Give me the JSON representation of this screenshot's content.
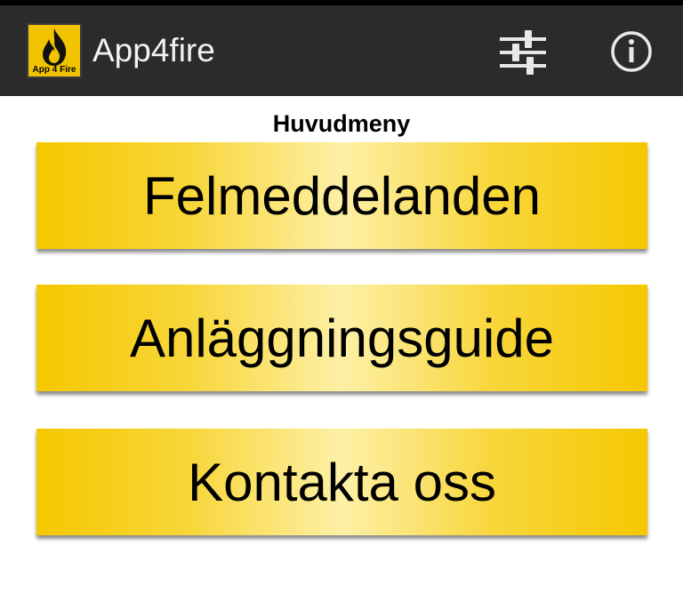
{
  "app": {
    "title": "App4fire",
    "logo_text": "App 4 Fire",
    "logo_icon": "flame-icon"
  },
  "actionbar": {
    "settings_icon": "sliders-icon",
    "info_icon": "info-icon"
  },
  "screen": {
    "title": "Huvudmeny"
  },
  "menu": {
    "items": [
      {
        "label": "Felmeddelanden"
      },
      {
        "label": "Anläggningsguide"
      },
      {
        "label": "Kontakta oss"
      }
    ]
  },
  "colors": {
    "actionbar": "#2b2b2b",
    "button_yellow": "#f5c800",
    "button_highlight": "#fdf0a6"
  }
}
